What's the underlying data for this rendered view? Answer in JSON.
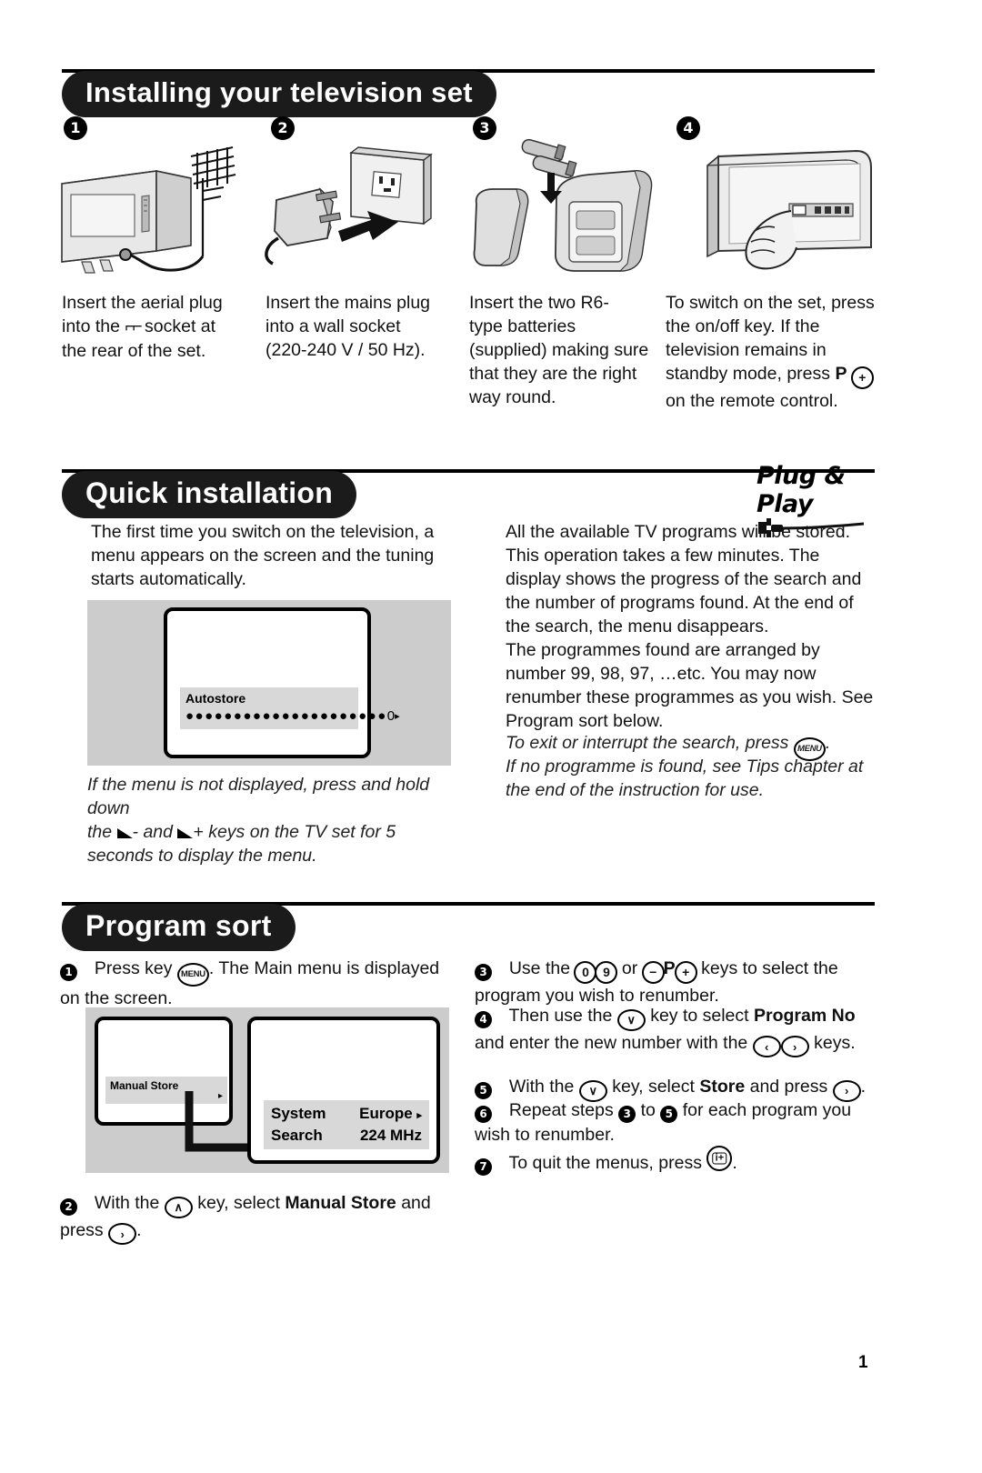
{
  "page": {
    "number": "1"
  },
  "section1": {
    "title": "Installing your television set",
    "steps": [
      {
        "num": "1",
        "illustration": "tv-with-aerial",
        "text_parts": [
          "Insert the aerial plug into the ",
          "aerial-socket-symbol",
          " socket at the rear of the set."
        ],
        "text": "Insert the aerial plug into the ⌐⌐ socket at the rear of the set."
      },
      {
        "num": "2",
        "illustration": "mains-plug-and-wall-socket",
        "text": "Insert the mains plug into a wall socket (220-240 V / 50 Hz)."
      },
      {
        "num": "3",
        "illustration": "remote-control-with-batteries",
        "text": "Insert the two R6-type batteries (supplied) making sure that they are the right way round."
      },
      {
        "num": "4",
        "illustration": "tv-side-power-button-hand",
        "text": "To switch on the set, press the on/off key. If the television remains in standby mode, press P + on the remote control."
      }
    ],
    "step1": {
      "line1": "Insert the aerial plug",
      "line2a": "into the",
      "line2b": "socket at",
      "line3": "the rear of the set."
    },
    "step2": {
      "line1": "Insert the mains plug",
      "line2": "into a wall socket",
      "line3": "(220-240 V / 50 Hz)."
    },
    "step3": {
      "line1": "Insert the two R6-",
      "line2": "type batteries",
      "line3": "(supplied) making sure",
      "line4": "that they are the right",
      "line5": "way round."
    },
    "step4": {
      "line1": "To switch on the set, press",
      "line2": "the on/off key. If the",
      "line3": "television remains in",
      "line4a": "standby mode, press",
      "line4b": "P",
      "line4c": "+",
      "line5": "on the remote control."
    }
  },
  "section2": {
    "title": "Quick installation",
    "logo": "Plug & Play",
    "left": {
      "para": "The first time you switch on the television, a menu appears on the screen and the tuning starts automatically.",
      "screen": {
        "menu_title": "Autostore",
        "progress_dots": "●●●●●●●●●●●●●●●●●●●●●",
        "progress_value": "0",
        "arrow": "▸"
      },
      "caption_l1": "If the menu is not displayed, press and hold down",
      "caption_l2a": "the",
      "caption_l2b": "- and",
      "caption_l2c": "+ keys on the TV set for 5",
      "caption_l3": "seconds to display the menu."
    },
    "right": {
      "para1": "All the available TV programs will be stored. This operation takes a few minutes. The display shows the progress of the search and the number of programs found. At the end of the search, the menu disappears.",
      "para2": "The programmes found are arranged by number 99, 98, 97, …etc. You may now renumber these programmes as you wish. See Program sort below.",
      "note1a": "To exit or interrupt the search, press",
      "note1_key": "MENU",
      "note1b": ".",
      "note2": "If no programme is found, see Tips chapter at the end of the instruction for use."
    }
  },
  "section3": {
    "title": "Program sort",
    "steps": {
      "s1": {
        "num": "1",
        "a": "Press key",
        "key": "MENU",
        "b": ". The Main menu is displayed on the screen."
      },
      "s2": {
        "num": "2",
        "a": "With the",
        "key1": "∧",
        "b": "key, select",
        "bold": "Manual Store",
        "c": "and press",
        "key2": "›",
        "d": "."
      },
      "s3": {
        "num": "3",
        "a": "Use the",
        "key1": "0",
        "key2": "9",
        "b": "or",
        "key3": "−",
        "boldP": "P",
        "key4": "+",
        "c": "keys to select the program you wish to renumber."
      },
      "s4": {
        "num": "4",
        "a": "Then use the",
        "key1": "∨",
        "b": "key to select",
        "bold": "Program No",
        "c": "and enter the new number with the",
        "key2": "‹",
        "key3": "›",
        "d": "keys."
      },
      "s5": {
        "num": "5",
        "a": "With the",
        "key1": "∨",
        "b": "key, select",
        "bold": "Store",
        "c": "and press",
        "key2": "›",
        "d": "."
      },
      "s6": {
        "num": "6",
        "a": "Repeat steps",
        "n1": "3",
        "b": "to",
        "n2": "5",
        "c": "for each program you wish to renumber."
      },
      "s7": {
        "num": "7",
        "a": "To quit the menus, press",
        "key": "i+",
        "b": "."
      }
    },
    "screens": {
      "left_menu_title": "Manual Store",
      "left_menu_arrow": "▸",
      "right_rows": [
        {
          "label": "System",
          "value": "Europe",
          "arrow": "▸"
        },
        {
          "label": "Search",
          "value": "224 MHz",
          "arrow": ""
        }
      ]
    }
  },
  "colors": {
    "pill_bg": "#1b1b1b",
    "screen_gray": "#cccccc",
    "menu_gray": "#d8d8d8",
    "text": "#111111"
  }
}
